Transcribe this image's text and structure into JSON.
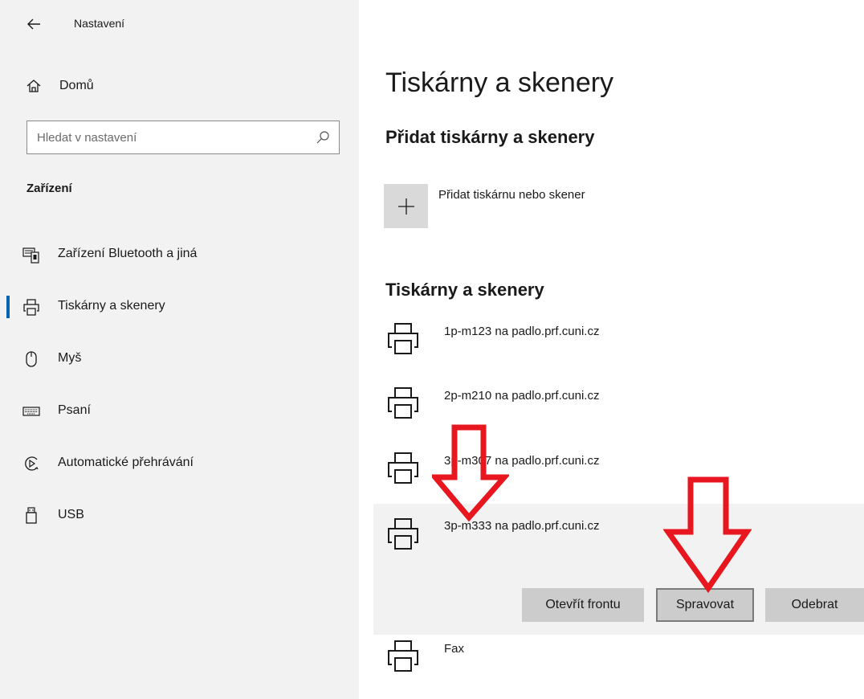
{
  "window": {
    "title": "Nastavení"
  },
  "sidebar": {
    "home_label": "Domů",
    "search_placeholder": "Hledat v nastavení",
    "section_title": "Zařízení",
    "items": [
      {
        "label": "Zařízení Bluetooth a jiná",
        "icon": "bluetooth-devices-icon"
      },
      {
        "label": "Tiskárny a skenery",
        "icon": "printer-icon",
        "active": true
      },
      {
        "label": "Myš",
        "icon": "mouse-icon"
      },
      {
        "label": "Psaní",
        "icon": "keyboard-icon"
      },
      {
        "label": "Automatické přehrávání",
        "icon": "autoplay-icon"
      },
      {
        "label": "USB",
        "icon": "usb-icon"
      }
    ]
  },
  "main": {
    "title": "Tiskárny a skenery",
    "add_section_title": "Přidat tiskárny a skenery",
    "add_label": "Přidat tiskárnu nebo skener",
    "list_title": "Tiskárny a skenery",
    "printers": [
      {
        "name": "1p-m123 na padlo.prf.cuni.cz"
      },
      {
        "name": "2p-m210 na padlo.prf.cuni.cz"
      },
      {
        "name": "3p-m307 na padlo.prf.cuni.cz"
      },
      {
        "name": "3p-m333 na padlo.prf.cuni.cz",
        "selected": true
      },
      {
        "name": "Fax"
      }
    ],
    "actions": {
      "open_queue": "Otevřít frontu",
      "manage": "Spravovat",
      "remove": "Odebrat"
    }
  },
  "colors": {
    "accent": "#0063b1",
    "annotation_arrow": "#e8161e",
    "sidebar_bg": "#f2f2f2",
    "selected_bg": "#f2f2f2",
    "button_bg": "#cccccc"
  }
}
